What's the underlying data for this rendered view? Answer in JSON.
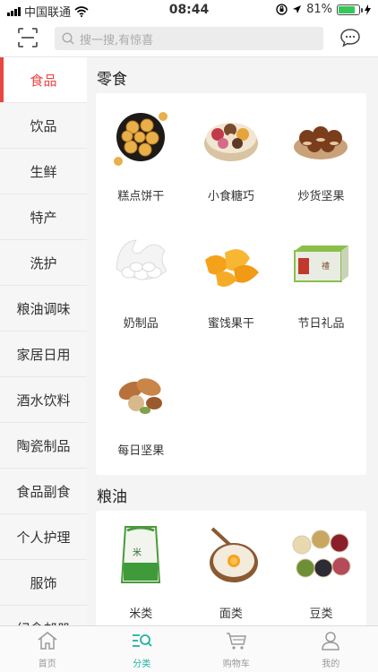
{
  "status_bar": {
    "carrier": "中国联通",
    "time": "08:44",
    "battery_percent": "81%",
    "battery_level": 0.81
  },
  "header": {
    "search_placeholder": "搜一搜,有惊喜"
  },
  "sidebar": {
    "active_index": 0,
    "items": [
      "食品",
      "饮品",
      "生鲜",
      "特产",
      "洗护",
      "粮油调味",
      "家居日用",
      "酒水饮料",
      "陶瓷制品",
      "食品副食",
      "个人护理",
      "服饰",
      "纪念邮册"
    ]
  },
  "sections": [
    {
      "title": "零食",
      "items": [
        {
          "label": "糕点饼干",
          "icon": "cookies-image"
        },
        {
          "label": "小食糖巧",
          "icon": "candy-image"
        },
        {
          "label": "炒货坚果",
          "icon": "chestnut-image"
        },
        {
          "label": "奶制品",
          "icon": "milk-image"
        },
        {
          "label": "蜜饯果干",
          "icon": "dried-mango-image"
        },
        {
          "label": "节日礼品",
          "icon": "gift-box-image"
        },
        {
          "label": "每日坚果",
          "icon": "mixed-nuts-image"
        }
      ]
    },
    {
      "title": "粮油",
      "items": [
        {
          "label": "米类",
          "icon": "rice-bag-image"
        },
        {
          "label": "面类",
          "icon": "flour-bowl-image"
        },
        {
          "label": "豆类",
          "icon": "beans-image"
        }
      ]
    }
  ],
  "tabbar": {
    "active_index": 1,
    "tabs": [
      {
        "label": "首页",
        "icon": "home-icon"
      },
      {
        "label": "分类",
        "icon": "category-icon"
      },
      {
        "label": "购物车",
        "icon": "cart-icon"
      },
      {
        "label": "我的",
        "icon": "profile-icon"
      }
    ]
  },
  "colors": {
    "accent_red": "#e9463f",
    "accent_teal": "#21b3a0"
  }
}
